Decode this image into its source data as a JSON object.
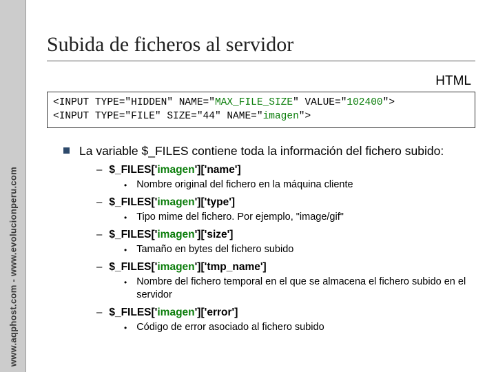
{
  "sidebar": {
    "text": "www.aqphost.com - www.evolucionperu.com"
  },
  "title": "Subida de ficheros al servidor",
  "html_label": "HTML",
  "code": {
    "line1_pre": "<INPUT TYPE=\"HIDDEN\" NAME=\"",
    "line1_name": "MAX_FILE_SIZE",
    "line1_mid": "\" VALUE=\"",
    "line1_val": "102400",
    "line1_end": "\">",
    "line2_pre": "<INPUT TYPE=\"FILE\" SIZE=\"44\" NAME=\"",
    "line2_name": "imagen",
    "line2_end": "\">"
  },
  "intro": "La variable $_FILES contiene toda la información del fichero subido:",
  "items": [
    {
      "key_pre": "$_FILES['",
      "key_green": "imagen",
      "key_post": "']['name']",
      "desc": "Nombre original del fichero en la máquina cliente"
    },
    {
      "key_pre": "$_FILES['",
      "key_green": "imagen",
      "key_post": "']['type']",
      "desc": "Tipo mime del fichero. Por ejemplo, \"image/gif\""
    },
    {
      "key_pre": "$_FILES['",
      "key_green": "imagen",
      "key_post": "']['size']",
      "desc": "Tamaño en bytes del fichero subido"
    },
    {
      "key_pre": "$_FILES['",
      "key_green": "imagen",
      "key_post": "']['tmp_name']",
      "desc": "Nombre del fichero temporal en el que se almacena el fichero subido en el servidor"
    },
    {
      "key_pre": "$_FILES['",
      "key_green": "imagen",
      "key_post": "']['error']",
      "desc": "Código de error asociado al fichero subido"
    }
  ]
}
